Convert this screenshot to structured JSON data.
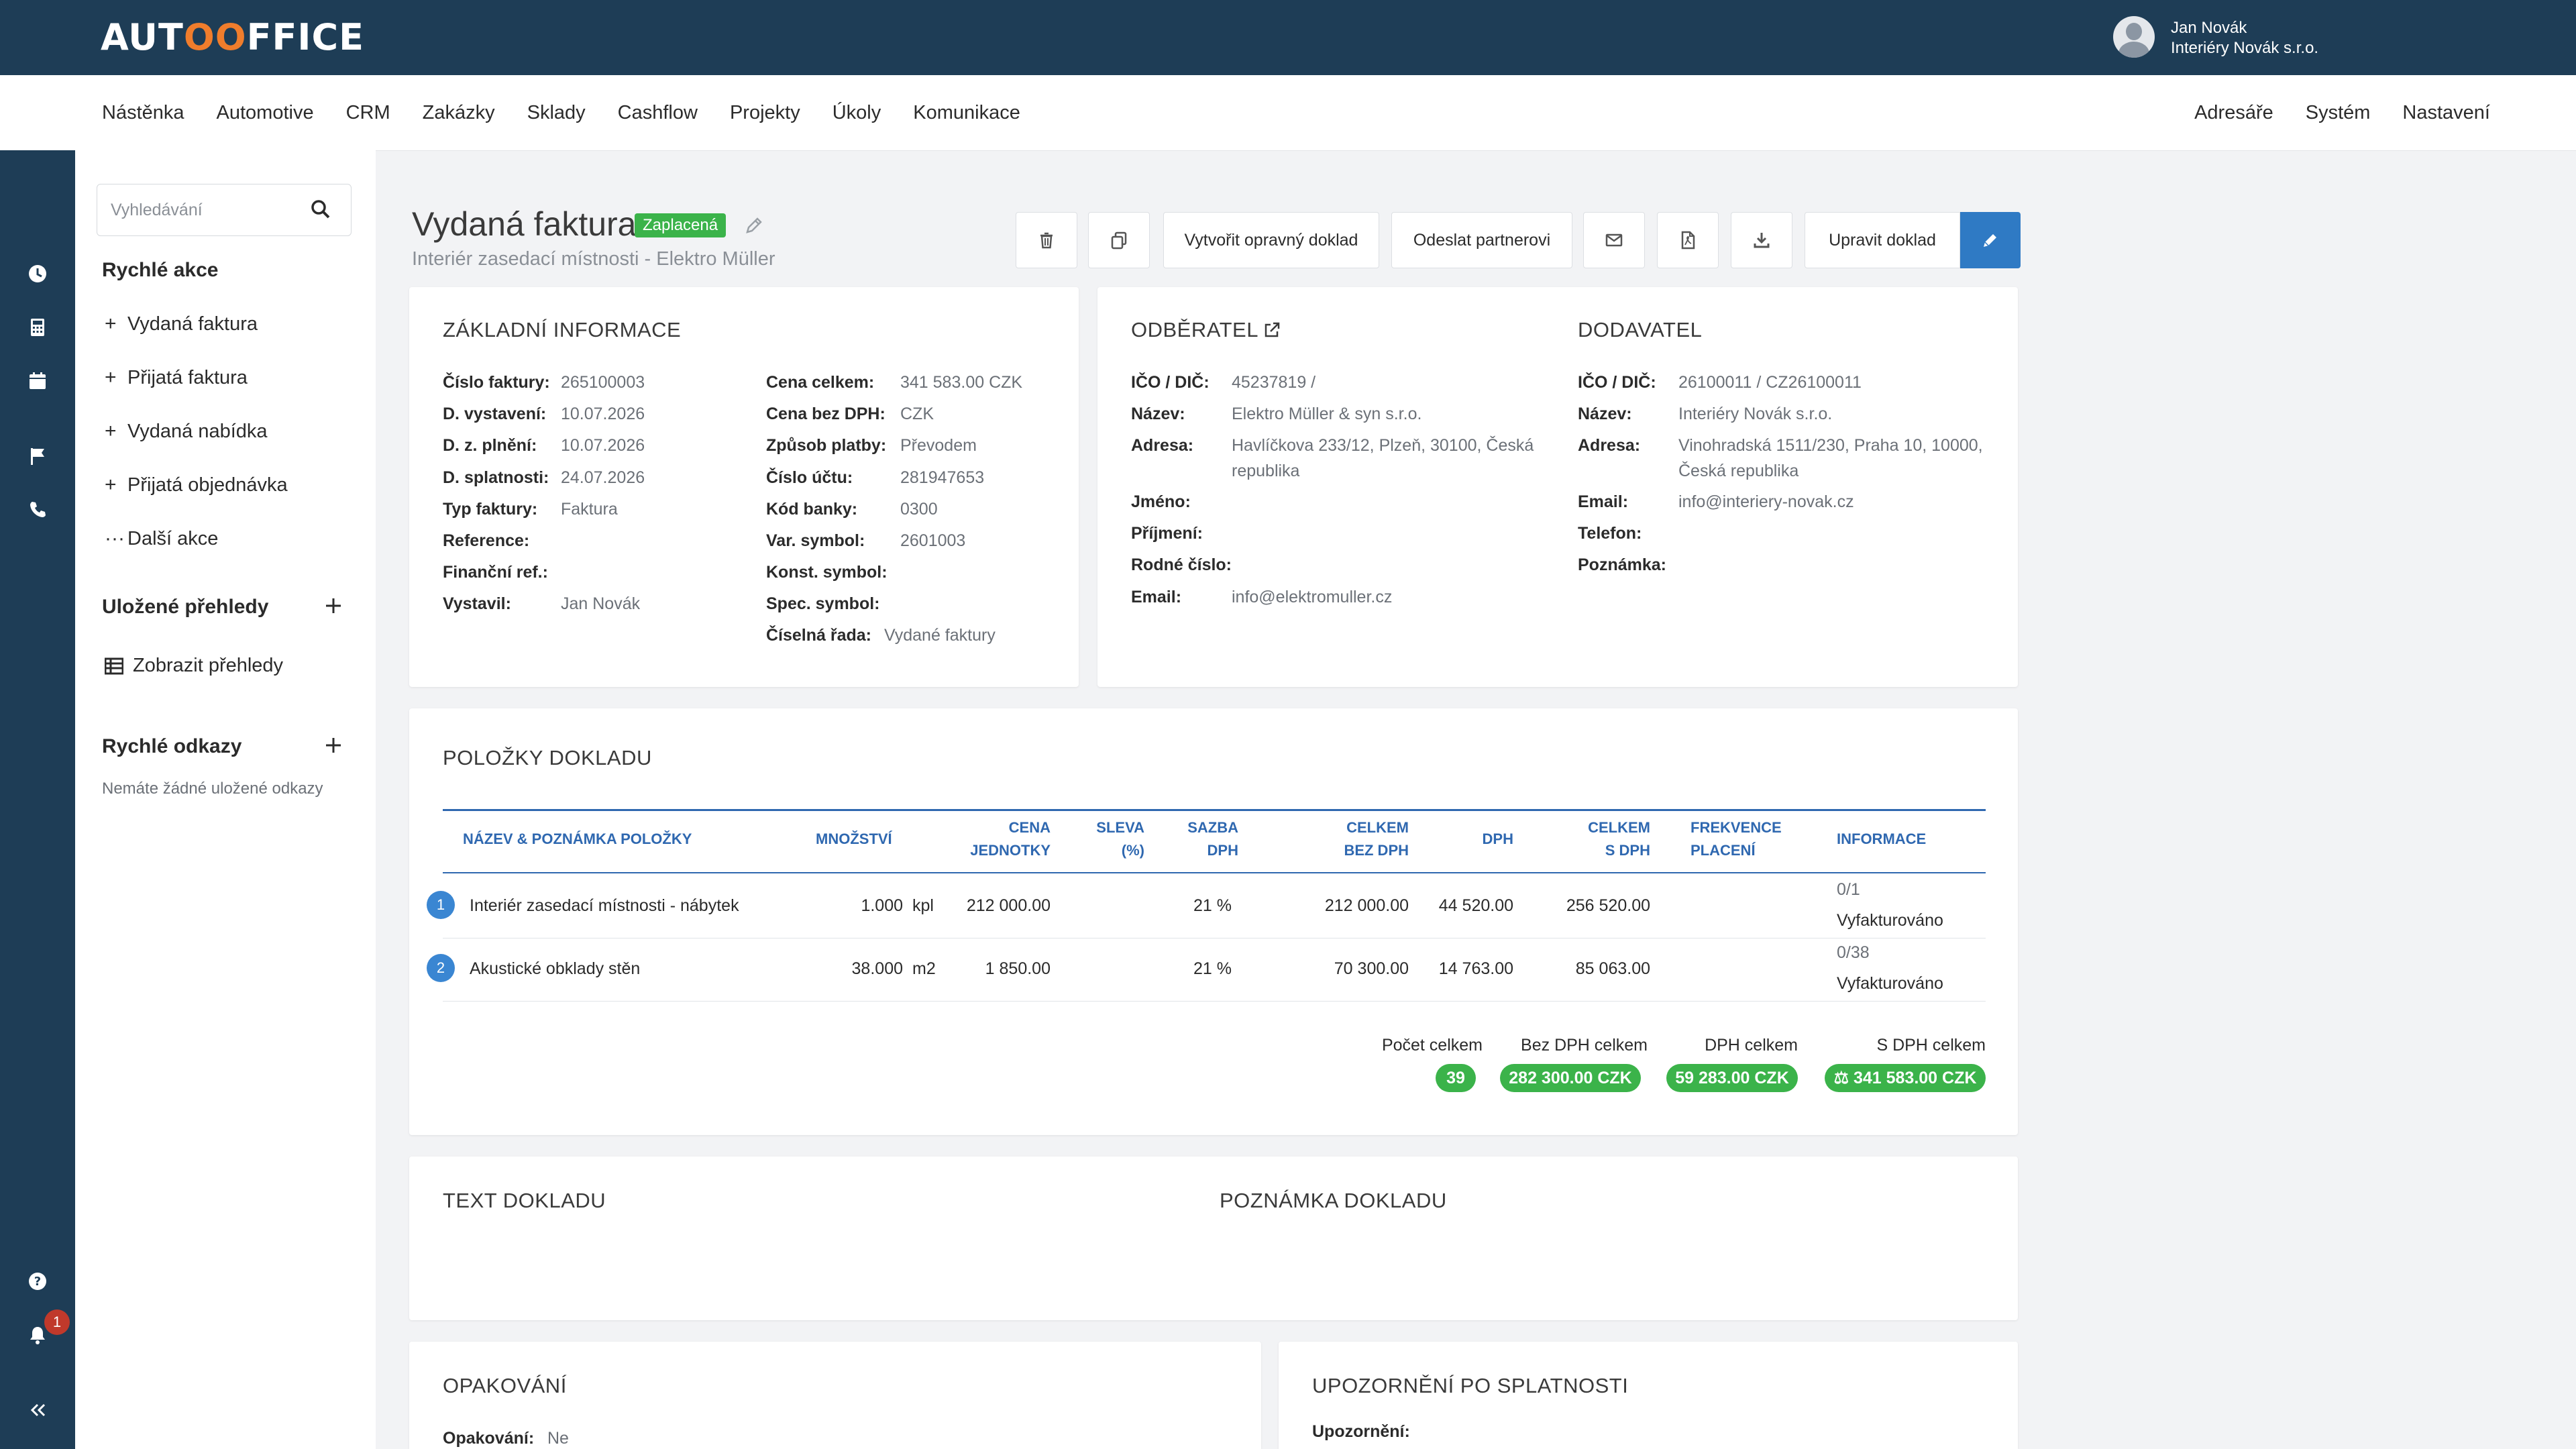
{
  "app": {
    "logo_left": "AUT",
    "logo_mid": "OO",
    "logo_right": "FFICE",
    "accent": "#f07d2c",
    "header_color": "#1e3d56"
  },
  "user": {
    "name": "Jan Novák",
    "company": "Interiéry Novák s.r.o."
  },
  "nav": {
    "left": [
      "Nástěnka",
      "Automotive",
      "CRM",
      "Zakázky",
      "Sklady",
      "Cashflow",
      "Projekty",
      "Úkoly",
      "Komunikace"
    ],
    "right": [
      "Adresáře",
      "Systém",
      "Nastavení"
    ]
  },
  "rail": {
    "icons": [
      "clock-icon",
      "calculator-icon",
      "calendar-icon",
      "flag-icon",
      "phone-icon",
      "help-icon",
      "bell-icon",
      "collapse-icon"
    ],
    "notifications": "1"
  },
  "sidebar": {
    "search_placeholder": "Vyhledávání",
    "quick_actions_title": "Rychlé akce",
    "quick_actions": [
      "Vydaná faktura",
      "Přijatá faktura",
      "Vydaná nabídka",
      "Přijatá objednávka"
    ],
    "more_actions": "Další akce",
    "saved_views_title": "Uložené přehledy",
    "show_views": "Zobrazit přehledy",
    "quick_links_title": "Rychlé odkazy",
    "quick_links_empty": "Nemáte žádné uložené odkazy"
  },
  "header": {
    "title": "Vydaná faktura",
    "status": "Zaplacená",
    "subtitle": "Interiér zasedací místnosti - Elektro Müller",
    "btn_corrective": "Vytvořit opravný doklad",
    "btn_send_partner": "Odeslat partnerovi",
    "btn_edit": "Upravit doklad"
  },
  "basic": {
    "title": "ZÁKLADNÍ INFORMACE",
    "left": [
      {
        "label": "Číslo faktury:",
        "value": "265100003"
      },
      {
        "label": "D. vystavení:",
        "value": "10.07.2026"
      },
      {
        "label": "D. z. plnění:",
        "value": "10.07.2026"
      },
      {
        "label": "D. splatnosti:",
        "value": "24.07.2026"
      },
      {
        "label": "Typ faktury:",
        "value": "Faktura"
      },
      {
        "label": "Reference:",
        "value": ""
      },
      {
        "label": "Finanční ref.:",
        "value": ""
      },
      {
        "label": "Vystavil:",
        "value": "Jan Novák"
      }
    ],
    "right": [
      {
        "label": "Cena celkem:",
        "value": "341 583.00 CZK"
      },
      {
        "label": "Cena bez DPH:",
        "value": "CZK"
      },
      {
        "label": "Způsob platby:",
        "value": "Převodem"
      },
      {
        "label": "Číslo účtu:",
        "value": "281947653"
      },
      {
        "label": "Kód banky:",
        "value": "0300"
      },
      {
        "label": "Var. symbol:",
        "value": "2601003"
      },
      {
        "label": "Konst. symbol:",
        "value": ""
      },
      {
        "label": "Spec. symbol:",
        "value": ""
      },
      {
        "label": "Číselná řada:",
        "value": "Vydané faktury"
      }
    ]
  },
  "customer": {
    "title": "ODBĚRATEL",
    "fields": [
      {
        "label": "IČO / DIČ:",
        "value": "45237819 /"
      },
      {
        "label": "Název:",
        "value": "Elektro Müller & syn s.r.o."
      },
      {
        "label": "Adresa:",
        "value": "Havlíčkova 233/12, Plzeň, 30100, Česká",
        "value2": "republika"
      },
      {
        "label": "Jméno:",
        "value": ""
      },
      {
        "label": "Příjmení:",
        "value": ""
      },
      {
        "label": "Rodné číslo:",
        "value": ""
      },
      {
        "label": "Email:",
        "value": "info@elektromuller.cz"
      }
    ]
  },
  "supplier": {
    "title": "DODAVATEL",
    "fields": [
      {
        "label": "IČO / DIČ:",
        "value": "26100011 / CZ26100011"
      },
      {
        "label": "Název:",
        "value": "Interiéry Novák s.r.o."
      },
      {
        "label": "Adresa:",
        "value": "Vinohradská 1511/230, Praha 10, 10000,",
        "value2": "Česká republika"
      },
      {
        "label": "Email:",
        "value": "info@interiery-novak.cz"
      },
      {
        "label": "Telefon:",
        "value": ""
      },
      {
        "label": "Poznámka:",
        "value": ""
      }
    ]
  },
  "items": {
    "title": "POLOŽKY DOKLADU",
    "columns": {
      "name": "NÁZEV & POZNÁMKA POLOŽKY",
      "qty": "MNOŽSTVÍ",
      "price1": "CENA",
      "price2": "JEDNOTKY",
      "disc1": "SLEVA",
      "disc2": "(%)",
      "vat1": "SAZBA",
      "vat2": "DPH",
      "net1": "CELKEM",
      "net2": "BEZ DPH",
      "vatamt": "DPH",
      "gross1": "CELKEM",
      "gross2": "S DPH",
      "freq1": "FREKVENCE",
      "freq2": "PLACENÍ",
      "info": "INFORMACE"
    },
    "rows": [
      {
        "num": "1",
        "name": "Interiér zasedací místnosti - nábytek",
        "qty": "1.000",
        "unit": "kpl",
        "price": "212 000.00",
        "vat_rate": "21 %",
        "net": "212 000.00",
        "vat": "44 520.00",
        "gross": "256 520.00",
        "info1": "0/1",
        "info2": "Vyfakturováno"
      },
      {
        "num": "2",
        "name": "Akustické obklady stěn",
        "qty": "38.000",
        "unit": "m2",
        "price": "1 850.00",
        "vat_rate": "21 %",
        "net": "70 300.00",
        "vat": "14 763.00",
        "gross": "85 063.00",
        "info1": "0/38",
        "info2": "Vyfakturováno"
      }
    ],
    "summary": {
      "count_label": "Počet celkem",
      "count": "39",
      "net_label": "Bez DPH celkem",
      "net": "282 300.00 CZK",
      "vat_label": "DPH celkem",
      "vat": "59 283.00 CZK",
      "gross_label": "S DPH celkem",
      "gross": "341 583.00 CZK"
    }
  },
  "text_card": {
    "title": "TEXT DOKLADU",
    "note_title": "POZNÁMKA DOKLADU"
  },
  "repeat": {
    "title": "OPAKOVÁNÍ",
    "label": "Opakování:",
    "value": "Ne"
  },
  "overdue": {
    "title": "UPOZORNĚNÍ PO SPLATNOSTI",
    "label": "Upozornění:"
  }
}
